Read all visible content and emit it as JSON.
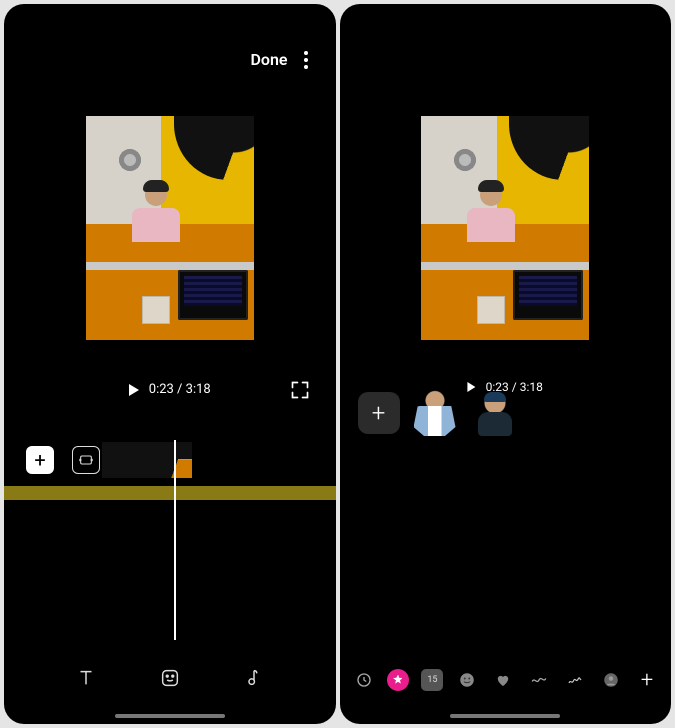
{
  "left": {
    "topbar": {
      "done_label": "Done"
    },
    "playback": {
      "time_display": "0:23 / 3:18"
    },
    "tools": {
      "text": "text-tool",
      "sticker": "sticker-tool",
      "music": "music-tool"
    }
  },
  "right": {
    "playback": {
      "time_display": "0:23 / 3:18"
    },
    "stickers": {
      "add_label": "+",
      "items": [
        {
          "name": "cutout-sticker-1"
        },
        {
          "name": "cutout-sticker-2"
        }
      ]
    },
    "categories": [
      {
        "name": "recent-icon"
      },
      {
        "name": "cutout-category-icon"
      },
      {
        "name": "date-sticker-icon",
        "label": "15"
      },
      {
        "name": "emoji-category-icon"
      },
      {
        "name": "heart-category-icon"
      },
      {
        "name": "scribble-category-icon"
      },
      {
        "name": "word-category-icon"
      },
      {
        "name": "avatar-category-icon"
      },
      {
        "name": "add-category-icon"
      }
    ]
  }
}
